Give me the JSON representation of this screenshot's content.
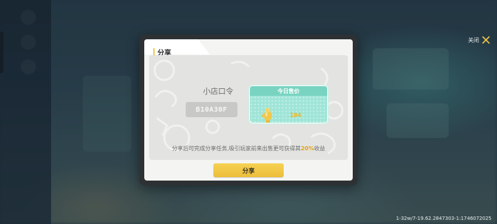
{
  "dialog": {
    "title": "分享",
    "close_label": "关闭",
    "shop_code_label": "小店口令",
    "shop_code_value": "B10A30F",
    "price_card_title": "今日售价",
    "price_value": "104",
    "description_prefix": "分享后可完成分享任务,吸引玩家前来出售更可获得其",
    "description_highlight": "20%",
    "description_suffix": "收益",
    "share_button_label": "分享"
  },
  "footer": {
    "build_info": "1-32w/7-19.62.2847303-1:1746072025"
  },
  "colors": {
    "accent_yellow": "#f2c84b",
    "card_mint": "#9fe5d7",
    "highlight_orange": "#e6a017"
  }
}
